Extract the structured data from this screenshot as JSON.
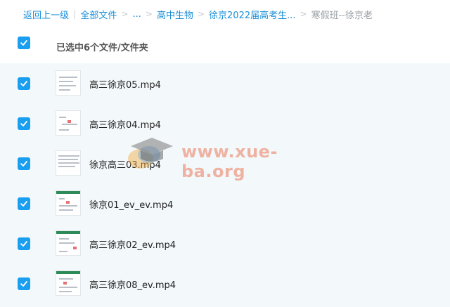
{
  "breadcrumb": {
    "back": "返回上一级",
    "all_files": "全部文件",
    "ellipsis": "...",
    "level1": "高中生物",
    "level2": "徐京2022届高考生...",
    "current": "寒假班--徐京老"
  },
  "selection": {
    "label": "已选中6个文件/文件夹",
    "checked": true
  },
  "files": [
    {
      "name": "高三徐京05.mp4",
      "checked": true
    },
    {
      "name": "高三徐京04.mp4",
      "checked": true
    },
    {
      "name": "徐京高三03.mp4",
      "checked": true
    },
    {
      "name": "徐京01_ev_ev.mp4",
      "checked": true
    },
    {
      "name": "高三徐京02_ev.mp4",
      "checked": true
    },
    {
      "name": "高三徐京08_ev.mp4",
      "checked": true
    }
  ],
  "watermark": {
    "text": "www.xue-ba.org"
  },
  "colors": {
    "link": "#1a8fd8",
    "checkbox": "#1a9ef0",
    "list_bg": "#f3f8fb"
  }
}
